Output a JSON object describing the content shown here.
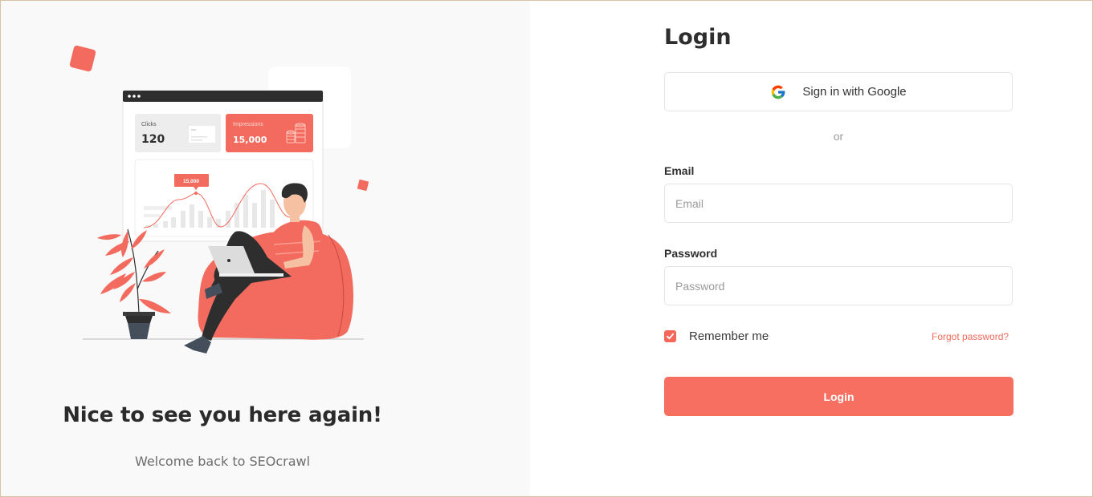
{
  "left_panel": {
    "headline": "Nice to see you here again!",
    "subline": "Welcome back to SEOcrawl",
    "illustration": {
      "clicks_label": "Clicks",
      "clicks_value": "120",
      "impressions_label": "Impressions",
      "impressions_value": "15,000",
      "chart_tooltip": "15,000"
    }
  },
  "login_form": {
    "title": "Login",
    "google_button_label": "Sign in with Google",
    "divider_text": "or",
    "email": {
      "label": "Email",
      "placeholder": "Email",
      "value": ""
    },
    "password": {
      "label": "Password",
      "placeholder": "Password",
      "value": ""
    },
    "remember_me": {
      "label": "Remember me",
      "checked": true
    },
    "forgot_password_label": "Forgot password?",
    "submit_label": "Login"
  },
  "icons": {
    "google": "google-logo-icon",
    "checkbox": "check-icon"
  },
  "colors": {
    "accent": "#f76f61",
    "headline": "#2b2b2b",
    "left_background": "#f9f9f9"
  }
}
